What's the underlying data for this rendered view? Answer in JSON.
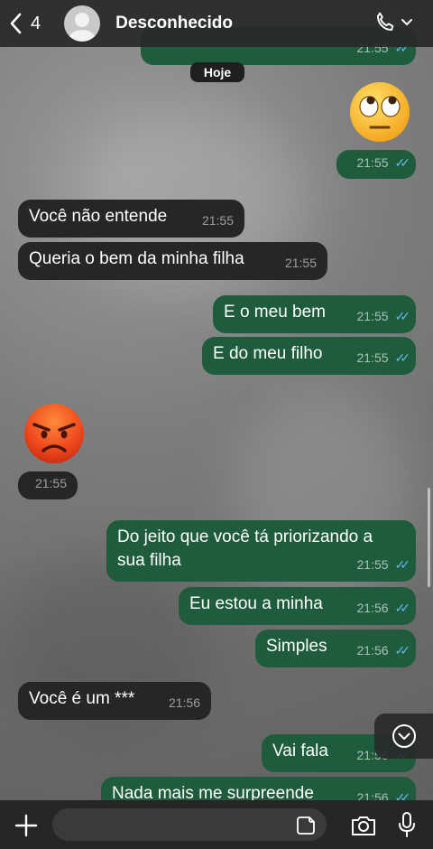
{
  "header": {
    "back_count": "4",
    "contact_name": "Desconhecido"
  },
  "date_separator": "Hoje",
  "messages": [
    {
      "dir": "out",
      "text": "",
      "time": "21:55",
      "read": true
    },
    {
      "dir": "out",
      "emoji": "face-with-rolling-eyes",
      "text": "",
      "time": "21:55",
      "read": true
    },
    {
      "dir": "in",
      "text": "Você não entende",
      "time": "21:55"
    },
    {
      "dir": "in",
      "text": "Queria o bem da minha filha",
      "time": "21:55"
    },
    {
      "dir": "out",
      "text": "E o meu bem",
      "time": "21:55",
      "read": true
    },
    {
      "dir": "out",
      "text": "E do meu filho",
      "time": "21:55",
      "read": true
    },
    {
      "dir": "in",
      "emoji": "angry-face",
      "text": "",
      "time": "21:55"
    },
    {
      "dir": "out",
      "text": "Do jeito que você tá priorizando a sua filha",
      "line1": "Do jeito que você tá priorizando a",
      "line2": "sua filha",
      "time": "21:55",
      "read": true
    },
    {
      "dir": "out",
      "text": "Eu estou a minha",
      "time": "21:56",
      "read": true
    },
    {
      "dir": "out",
      "text": "Simples",
      "time": "21:56",
      "read": true
    },
    {
      "dir": "in",
      "text": "Você é um ***",
      "time": "21:56"
    },
    {
      "dir": "out",
      "text": "Vai fala",
      "time": "21:56",
      "read": true
    },
    {
      "dir": "out",
      "text": "Nada mais me surpreende",
      "time": "21:56",
      "read": true
    }
  ],
  "composer": {
    "placeholder": ""
  },
  "colors": {
    "outgoing_bubble": "#1f5c3d",
    "incoming_bubble": "#262626",
    "read_ticks": "#5fb7ea"
  },
  "icons": {
    "back": "chevron-left-icon",
    "call": "phone-icon",
    "add": "plus-icon",
    "sticker": "sticker-icon",
    "camera": "camera-icon",
    "mic": "microphone-icon",
    "scroll": "chevron-down-circle-icon"
  }
}
